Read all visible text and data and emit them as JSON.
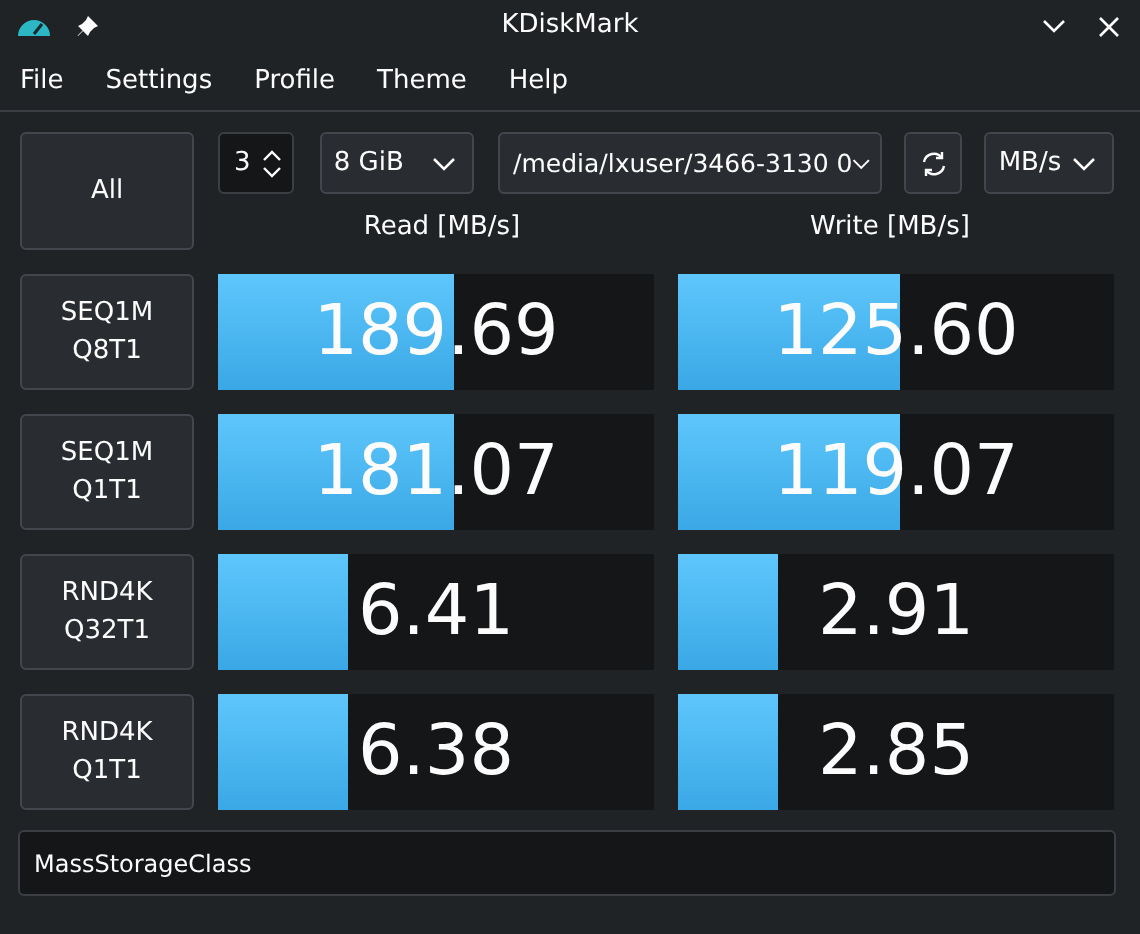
{
  "window": {
    "title": "KDiskMark"
  },
  "menu": [
    "File",
    "Settings",
    "Profile",
    "Theme",
    "Help"
  ],
  "toolbar": {
    "all_button": "All",
    "runs": "3",
    "size": "8 GiB",
    "target": "/media/lxuser/3466-3130 0",
    "units": "MB/s"
  },
  "columns": [
    "Read [MB/s]",
    "Write [MB/s]"
  ],
  "tests": [
    {
      "name": "SEQ1M",
      "params": "Q8T1",
      "read": {
        "value": "189.69",
        "level": 0.54
      },
      "write": {
        "value": "125.60",
        "level": 0.51
      }
    },
    {
      "name": "SEQ1M",
      "params": "Q1T1",
      "read": {
        "value": "181.07",
        "level": 0.54
      },
      "write": {
        "value": "119.07",
        "level": 0.51
      }
    },
    {
      "name": "RND4K",
      "params": "Q32T1",
      "read": {
        "value": "6.41",
        "level": 0.3
      },
      "write": {
        "value": "2.91",
        "level": 0.23
      }
    },
    {
      "name": "RND4K",
      "params": "Q1T1",
      "read": {
        "value": "6.38",
        "level": 0.3
      },
      "write": {
        "value": "2.85",
        "level": 0.23
      }
    }
  ],
  "profile": {
    "value": "MassStorageClass"
  }
}
